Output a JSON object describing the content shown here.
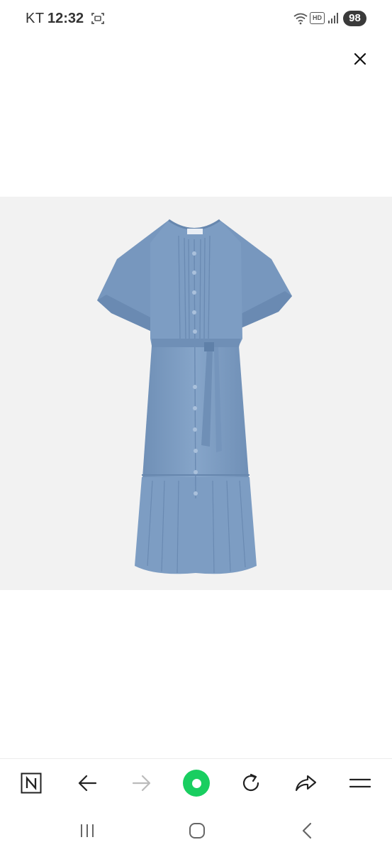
{
  "status_bar": {
    "carrier": "KT",
    "time": "12:32",
    "hd_label": "HD",
    "battery": "98"
  },
  "viewer": {
    "product_label_tag": "CURNIT",
    "colors": {
      "dress": "#7d9dc3",
      "dress_shadow": "#6787ae",
      "background": "#f2f2f2",
      "accent_green": "#19ce60"
    }
  },
  "toolbar": {
    "home_icon": "naver-n-icon",
    "back_icon": "arrow-left-icon",
    "forward_icon": "arrow-right-icon",
    "green_icon": "green-dot-icon",
    "reload_icon": "reload-icon",
    "share_icon": "share-icon",
    "menu_icon": "hamburger-menu-icon"
  }
}
